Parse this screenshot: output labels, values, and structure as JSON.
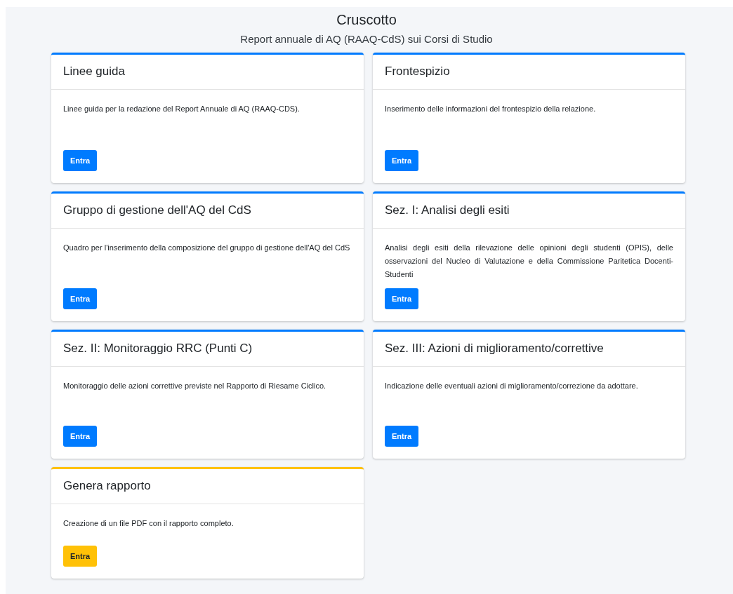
{
  "header": {
    "title": "Cruscotto",
    "subtitle": "Report annuale di AQ (RAAQ-CdS) sui Corsi di Studio"
  },
  "cards": [
    {
      "title": "Linee guida",
      "description": "Linee guida per la redazione del Report Annuale di AQ (RAAQ-CDS).",
      "button": "Entra",
      "color": "#007bff"
    },
    {
      "title": "Frontespizio",
      "description": "Inserimento delle informazioni del frontespizio della relazione.",
      "button": "Entra",
      "color": "#007bff"
    },
    {
      "title": "Gruppo di gestione dell'AQ del CdS",
      "description": "Quadro per l'inserimento della composizione del gruppo di gestione dell'AQ del CdS",
      "button": "Entra",
      "color": "#007bff"
    },
    {
      "title": "Sez. I: Analisi degli esiti",
      "description": "Analisi degli esiti della rilevazione delle opinioni degli studenti (OPIS), delle osservazioni del Nucleo di Valutazione e della Commissione Paritetica Docenti-Studenti",
      "button": "Entra",
      "color": "#007bff"
    },
    {
      "title": "Sez. II: Monitoraggio RRC (Punti C)",
      "description": "Monitoraggio delle azioni correttive previste nel Rapporto di Riesame Ciclico.",
      "button": "Entra",
      "color": "#007bff"
    },
    {
      "title": "Sez. III: Azioni di miglioramento/correttive",
      "description": "Indicazione delle eventuali azioni di miglioramento/correzione da adottare.",
      "button": "Entra",
      "color": "#007bff"
    },
    {
      "title": "Genera rapporto",
      "description": "Creazione di un file PDF con il rapporto completo.",
      "button": "Entra",
      "color": "#ffc107"
    }
  ]
}
